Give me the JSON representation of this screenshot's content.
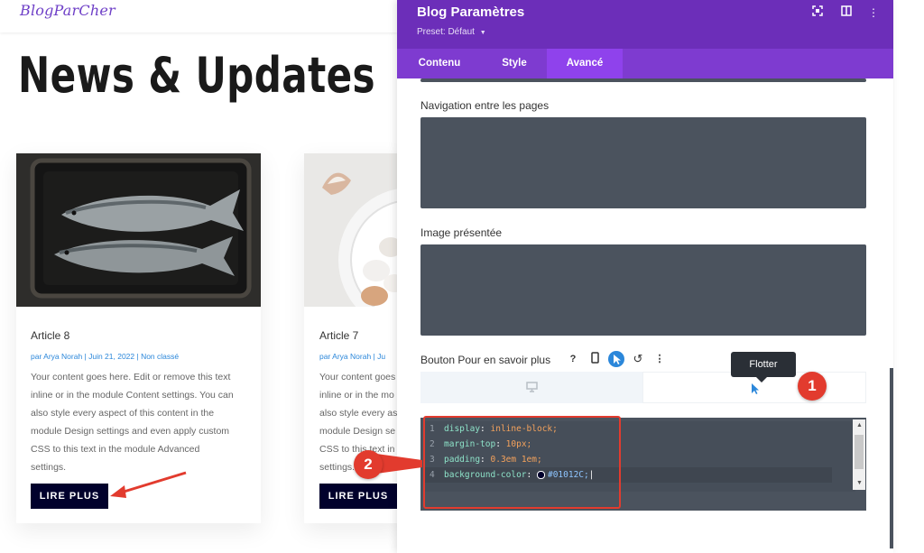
{
  "site": {
    "logo": "BlogParCher",
    "page_title": "News & Updates",
    "articles": [
      {
        "title": "Article 8",
        "meta": "par Arya Norah | Juin 21, 2022 | Non classé",
        "text_lines": [
          "Your content goes here. Edit or remove this text",
          "inline or in the module Content settings. You can",
          "also style every aspect of this content in the",
          "module Design settings and even apply custom",
          "CSS to this text in the module Advanced",
          "settings."
        ],
        "button": "LIRE PLUS"
      },
      {
        "title": "Article 7",
        "meta": "par Arya Norah | Ju",
        "text_lines": [
          "Your content goes",
          "inline or in the mo",
          "also style every as",
          "module Design se",
          "CSS to this text in",
          "settings."
        ],
        "button": "LIRE PLUS"
      }
    ]
  },
  "panel": {
    "title": "Blog Paramètres",
    "preset": "Preset: Défaut",
    "tabs": [
      {
        "label": "Contenu",
        "active": false
      },
      {
        "label": "Style",
        "active": false
      },
      {
        "label": "Avancé",
        "active": true
      }
    ],
    "sections": {
      "navigation": "Navigation entre les pages",
      "featured_image": "Image présentée",
      "read_more_button": "Bouton Pour en savoir plus"
    },
    "tooltip": "Flotter",
    "code_lines": [
      {
        "num": "1",
        "prop": "display",
        "value": "inline-block;"
      },
      {
        "num": "2",
        "prop": "margin-top",
        "value": "10px;"
      },
      {
        "num": "3",
        "prop": "padding",
        "value": "0.3em 1em;"
      },
      {
        "num": "4",
        "prop": "background-color",
        "value": "#01012C;"
      }
    ]
  },
  "annotations": {
    "badge1": "1",
    "badge2": "2"
  },
  "colors": {
    "accent": "#6c2eb9",
    "button": "#01012c",
    "annotation": "#e23b2e",
    "code_bg": "#4b535e"
  }
}
